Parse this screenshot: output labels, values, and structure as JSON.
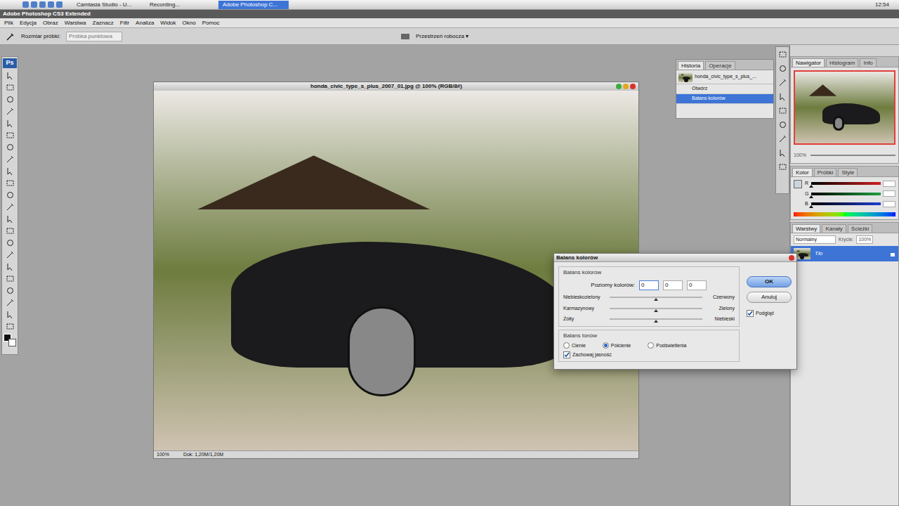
{
  "menubar": {
    "apple": "",
    "tabs": [
      {
        "label": "Camtasia Studio - U...",
        "selected": false
      },
      {
        "label": "Recording...",
        "selected": false
      },
      {
        "label": "Adobe Photoshop C...",
        "selected": true
      }
    ],
    "clock": "12:54"
  },
  "app": {
    "title": "Adobe Photoshop CS3 Extended",
    "menu": [
      "Plik",
      "Edycja",
      "Obraz",
      "Warstwa",
      "Zaznacz",
      "Filtr",
      "Analiza",
      "Widok",
      "Okno",
      "Pomoc"
    ]
  },
  "options_bar": {
    "sample_label": "Rozmiar próbki:",
    "sample_value": "Próbka punktowa",
    "workspace": "Przestrzeń robocza ▾"
  },
  "toolbox": {
    "logo": "Ps"
  },
  "document": {
    "title": "honda_civic_type_s_plus_2007_01.jpg @ 100% (RGB/8#)",
    "zoom": "100%",
    "status": "Dok: 1,20M/1,20M"
  },
  "history": {
    "tabs": [
      {
        "label": "Historia",
        "selected": true
      },
      {
        "label": "Operacje",
        "selected": false
      }
    ],
    "snapshot": "honda_civic_type_s_plus_...",
    "items": [
      {
        "label": "Otwórz",
        "selected": false
      },
      {
        "label": "Balans kolorów",
        "selected": true
      }
    ]
  },
  "navigator": {
    "tabs": [
      {
        "label": "Nawigator",
        "selected": true
      },
      {
        "label": "Histogram",
        "selected": false
      },
      {
        "label": "Info",
        "selected": false
      }
    ],
    "zoom": "100%"
  },
  "color": {
    "tabs": [
      {
        "label": "Kolor",
        "selected": true
      },
      {
        "label": "Próbki",
        "selected": false
      },
      {
        "label": "Style",
        "selected": false
      }
    ],
    "channels": [
      {
        "name": "R",
        "level": 0.0,
        "color": "#d02020"
      },
      {
        "name": "G",
        "level": 0.0,
        "color": "#20a040"
      },
      {
        "name": "B",
        "level": 0.0,
        "color": "#2040d0"
      }
    ]
  },
  "layers": {
    "tabs": [
      {
        "label": "Warstwy",
        "selected": true
      },
      {
        "label": "Kanały",
        "selected": false
      },
      {
        "label": "Ścieżki",
        "selected": false
      }
    ],
    "blend": "Normalny",
    "opacity_label": "Krycie:",
    "opacity": "100%",
    "items": [
      {
        "name": "Tło",
        "selected": true
      }
    ]
  },
  "dialog": {
    "title": "Balans kolorów",
    "group": "Balans kolorów",
    "levels_label": "Poziomy kolorów:",
    "levels": [
      "0",
      "0",
      "0"
    ],
    "sliders": [
      {
        "left": "Niebieskozielony",
        "right": "Czerwony",
        "level": 0.5
      },
      {
        "left": "Karmazynowy",
        "right": "Zielony",
        "level": 0.5
      },
      {
        "left": "Żółty",
        "right": "Niebieski",
        "level": 0.5
      }
    ],
    "tone_group": "Balans tonów",
    "tones": [
      {
        "label": "Cienie",
        "selected": false
      },
      {
        "label": "Półcienie",
        "selected": true
      },
      {
        "label": "Podświetlenia",
        "selected": false
      }
    ],
    "preserve": {
      "label": "Zachowaj jasność",
      "checked": true
    },
    "buttons": [
      {
        "label": "OK",
        "default": true
      },
      {
        "label": "Anuluj",
        "default": false
      }
    ],
    "preview": {
      "label": "Podgląd",
      "checked": true
    }
  }
}
